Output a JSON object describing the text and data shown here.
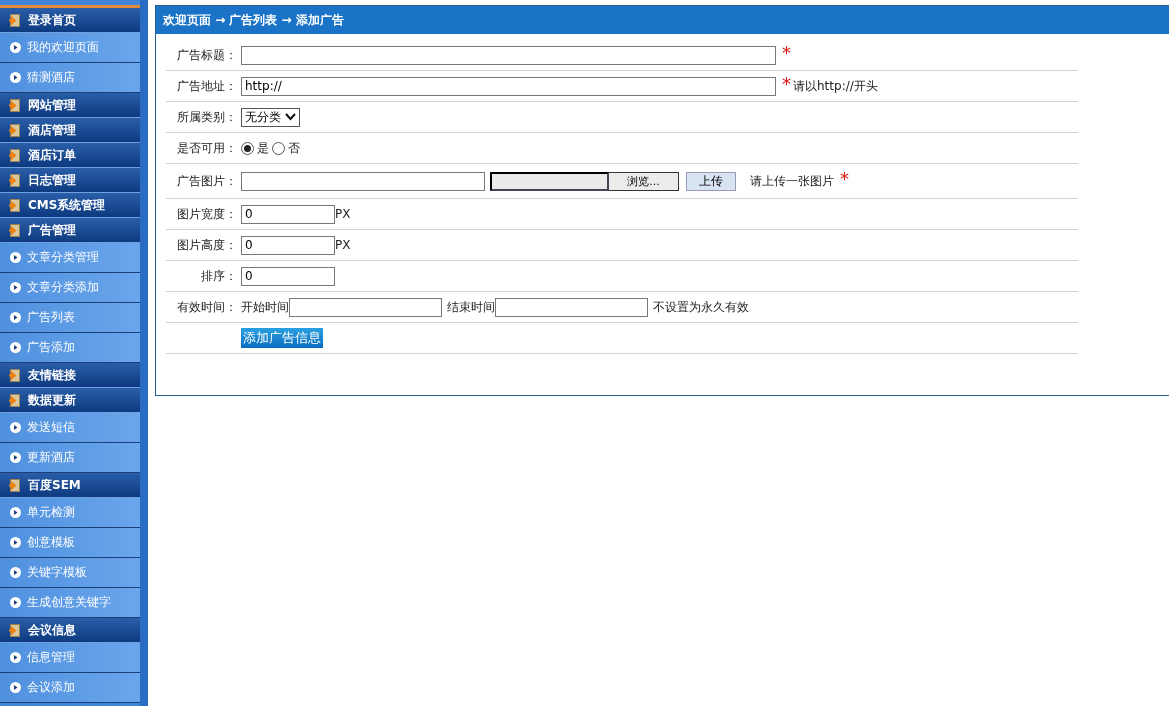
{
  "sidebar": {
    "items": [
      {
        "kind": "header",
        "label": "登录首页"
      },
      {
        "kind": "link",
        "label": "我的欢迎页面"
      },
      {
        "kind": "link",
        "label": "猜测酒店"
      },
      {
        "kind": "header",
        "label": "网站管理"
      },
      {
        "kind": "header",
        "label": "酒店管理"
      },
      {
        "kind": "header",
        "label": "酒店订单"
      },
      {
        "kind": "header",
        "label": "日志管理"
      },
      {
        "kind": "header",
        "label": "CMS系统管理"
      },
      {
        "kind": "header",
        "label": "广告管理"
      },
      {
        "kind": "link",
        "label": "文章分类管理"
      },
      {
        "kind": "link",
        "label": "文章分类添加"
      },
      {
        "kind": "link",
        "label": "广告列表"
      },
      {
        "kind": "link",
        "label": "广告添加"
      },
      {
        "kind": "header",
        "label": "友情链接"
      },
      {
        "kind": "header",
        "label": "数据更新"
      },
      {
        "kind": "link",
        "label": "发送短信"
      },
      {
        "kind": "link",
        "label": "更新酒店"
      },
      {
        "kind": "header",
        "label": "百度SEM"
      },
      {
        "kind": "link",
        "label": "单元检测"
      },
      {
        "kind": "link",
        "label": "创意模板"
      },
      {
        "kind": "link",
        "label": "关键字模板"
      },
      {
        "kind": "link",
        "label": "生成创意关键字"
      },
      {
        "kind": "header",
        "label": "会议信息"
      },
      {
        "kind": "link",
        "label": "信息管理"
      },
      {
        "kind": "link",
        "label": "会议添加"
      }
    ]
  },
  "breadcrumb": "欢迎页面 → 广告列表 → 添加广告",
  "form": {
    "rows": [
      {
        "kind": "text",
        "label": "广告标题：",
        "value": "",
        "required_mark": "*"
      },
      {
        "kind": "text",
        "label": "广告地址：",
        "value": "http://",
        "required_mark": "*",
        "hint": "请以http://开头"
      },
      {
        "kind": "select",
        "label": "所属类别：",
        "value": "无分类"
      },
      {
        "kind": "radio",
        "label": "是否可用：",
        "options": [
          {
            "label": "是",
            "selected": true
          },
          {
            "label": "否",
            "selected": false
          }
        ]
      },
      {
        "kind": "file",
        "label": "广告图片：",
        "value": "",
        "browse": "浏览...",
        "upload": "上传",
        "hint": "请上传一张图片",
        "required_mark": "*"
      },
      {
        "kind": "number",
        "label": "图片宽度：",
        "value": "0",
        "unit": "PX"
      },
      {
        "kind": "number",
        "label": "图片高度：",
        "value": "0",
        "unit": "PX"
      },
      {
        "kind": "number",
        "label": "排序：",
        "value": "0"
      },
      {
        "kind": "daterange",
        "label": "有效时间：",
        "start_label": "开始时间",
        "start_value": "",
        "end_label": "结束时间",
        "end_value": "",
        "hint": "不设置为永久有效"
      },
      {
        "kind": "submit",
        "button": "添加广告信息"
      }
    ]
  }
}
